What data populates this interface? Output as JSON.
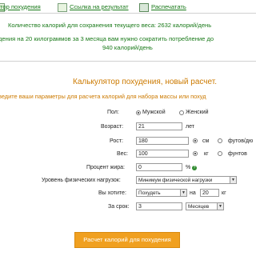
{
  "top_links": {
    "diary": "тор похудения",
    "link_result": "Ссылка на результат",
    "print": "Распечатать"
  },
  "info": {
    "line1": "Количество калорий для сохранения текущего веса: 2632 калорий/день",
    "line2": "дения на 20 килограммов за 3 месяца вам нужно сократить потребление до",
    "line3": "940 калорий/день"
  },
  "calculator": {
    "title": "Калькулятор похудения, новый расчет.",
    "subtitle": "ведите ваши параметры для расчета калорий для набора массы или похуд",
    "sex": {
      "label": "Пол:",
      "male": "Мужской",
      "female": "Женский",
      "selected": "male"
    },
    "age": {
      "label": "Возраст:",
      "value": "21",
      "unit": "лет"
    },
    "height": {
      "label": "Рост:",
      "value": "180",
      "unit_cm": "см",
      "unit_ft": "футов/дю",
      "selected": "cm"
    },
    "weight": {
      "label": "Вес:",
      "value": "100",
      "unit_kg": "кг",
      "unit_lb": "фунтов",
      "selected": "kg"
    },
    "fat": {
      "label": "Процент жира:",
      "value": "0",
      "unit": "%",
      "help": "?"
    },
    "activity": {
      "label": "Уровень физических нагрузок:",
      "value": "Минимум физической нагрузки"
    },
    "goal": {
      "label": "Вы хотите:",
      "value": "Похудеть",
      "on_label": "на",
      "amount": "20",
      "amount_unit": "кг"
    },
    "period": {
      "label": "За срок:",
      "value": "3",
      "unit": "Месяцев"
    },
    "submit": "Расчет калорий для похудения"
  },
  "colors": {
    "link_green": "#1a7a1a",
    "title_orange": "#cc7a00",
    "button_orange": "#f0a020"
  }
}
